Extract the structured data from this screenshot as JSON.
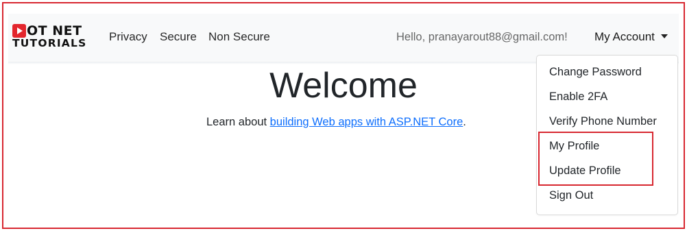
{
  "brand": {
    "line1": "OT NET",
    "line2": "TUTORIALS",
    "icon": "play-icon",
    "accent": "#e3262d"
  },
  "nav": {
    "links": [
      "Privacy",
      "Secure",
      "Non Secure"
    ],
    "greeting": "Hello, pranayarout88@gmail.com!",
    "account_label": "My Account",
    "account_icon": "caret-down-icon"
  },
  "main": {
    "heading": "Welcome",
    "learn_prefix": "Learn about ",
    "learn_link": "building Web apps with ASP.NET Core",
    "learn_suffix": "."
  },
  "dropdown": {
    "items": [
      "Change Password",
      "Enable 2FA",
      "Verify Phone Number",
      "My Profile",
      "Update Profile",
      "Sign Out"
    ]
  },
  "colors": {
    "highlight_border": "#d7262f",
    "link": "#0d6efd",
    "navbar_bg": "#f8f9fa"
  }
}
